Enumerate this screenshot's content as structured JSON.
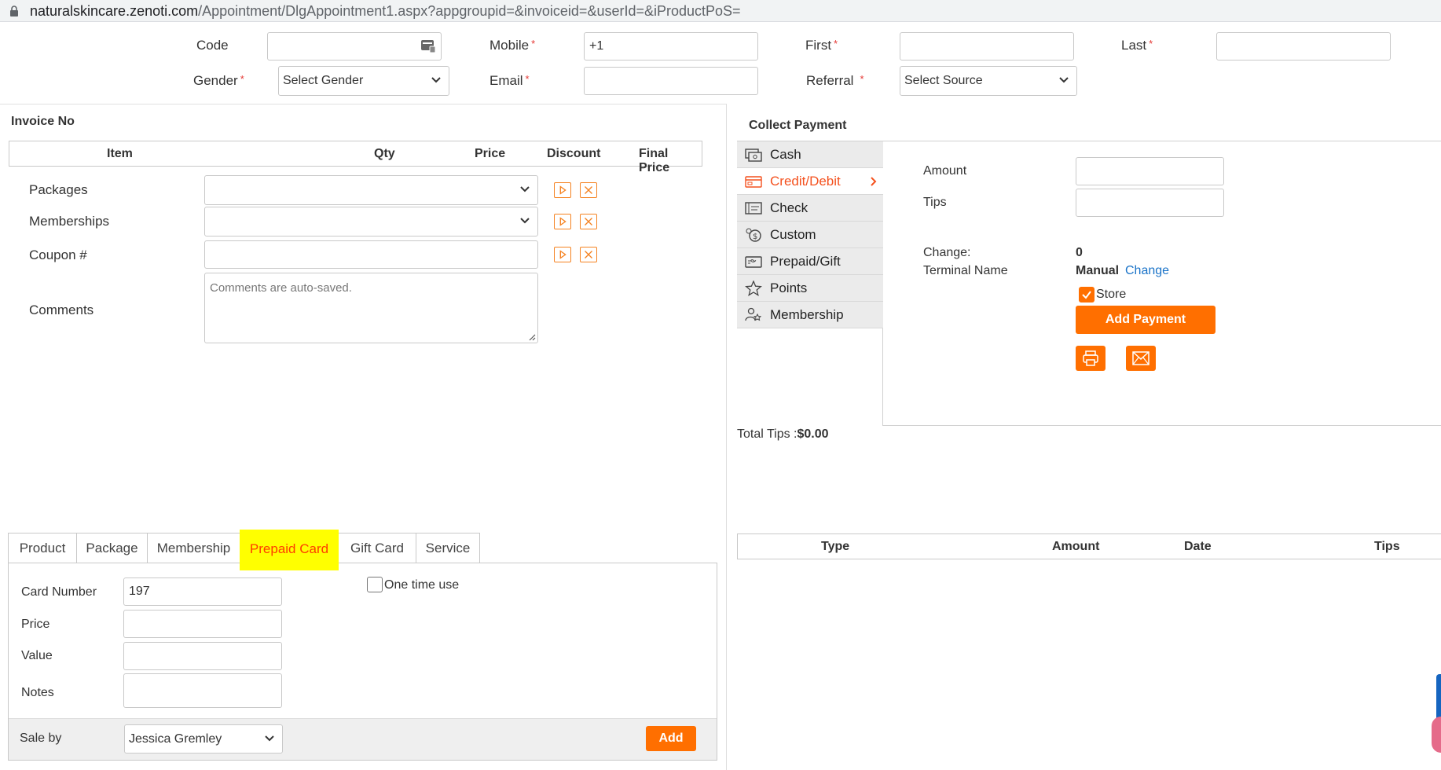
{
  "browser": {
    "url_host": "naturalskincare.zenoti.com",
    "url_path": "/Appointment/DlgAppointment1.aspx?appgroupid=&invoiceid=&userId=&iProductPoS="
  },
  "guest": {
    "code_label": "Code",
    "mobile_label": "Mobile",
    "mobile_value": "+1",
    "first_label": "First",
    "last_label": "Last",
    "gender_label": "Gender",
    "gender_value": "Select Gender",
    "email_label": "Email",
    "referral_label": "Referral",
    "referral_value": "Select Source",
    "required_mark": "*"
  },
  "invoice": {
    "title": "Invoice No",
    "columns": [
      "Item",
      "Qty",
      "Price",
      "Discount",
      "Final Price"
    ],
    "rows": {
      "packages": "Packages",
      "memberships": "Memberships",
      "coupon": "Coupon #",
      "comments": "Comments"
    },
    "comments_placeholder": "Comments are auto-saved."
  },
  "tabs": [
    "Product",
    "Package",
    "Membership",
    "Prepaid Card",
    "Gift Card",
    "Service"
  ],
  "prepaid_form": {
    "card_number_label": "Card Number",
    "card_number_value": "197",
    "price_label": "Price",
    "value_label": "Value",
    "notes_label": "Notes",
    "one_time_label": "One time use",
    "sale_by_label": "Sale by",
    "sale_by_value": "Jessica Gremley",
    "add_label": "Add"
  },
  "payment": {
    "title": "Collect Payment",
    "methods": [
      "Cash",
      "Credit/Debit",
      "Check",
      "Custom",
      "Prepaid/Gift",
      "Points",
      "Membership"
    ],
    "amount_label": "Amount",
    "tips_label": "Tips",
    "change_label": "Change:",
    "change_value": "0",
    "terminal_label": "Terminal Name",
    "terminal_value": "Manual",
    "terminal_change_link": "Change",
    "store_label": "Store",
    "add_payment_label": "Add Payment",
    "total_tips_label": "Total Tips :",
    "total_tips_value": "$0.00"
  },
  "payments_table": {
    "columns": [
      "Type",
      "Amount",
      "Date",
      "Tips"
    ]
  },
  "colors": {
    "accent": "#ff6f00",
    "highlight": "#ffff00",
    "link": "#1a73c8"
  }
}
